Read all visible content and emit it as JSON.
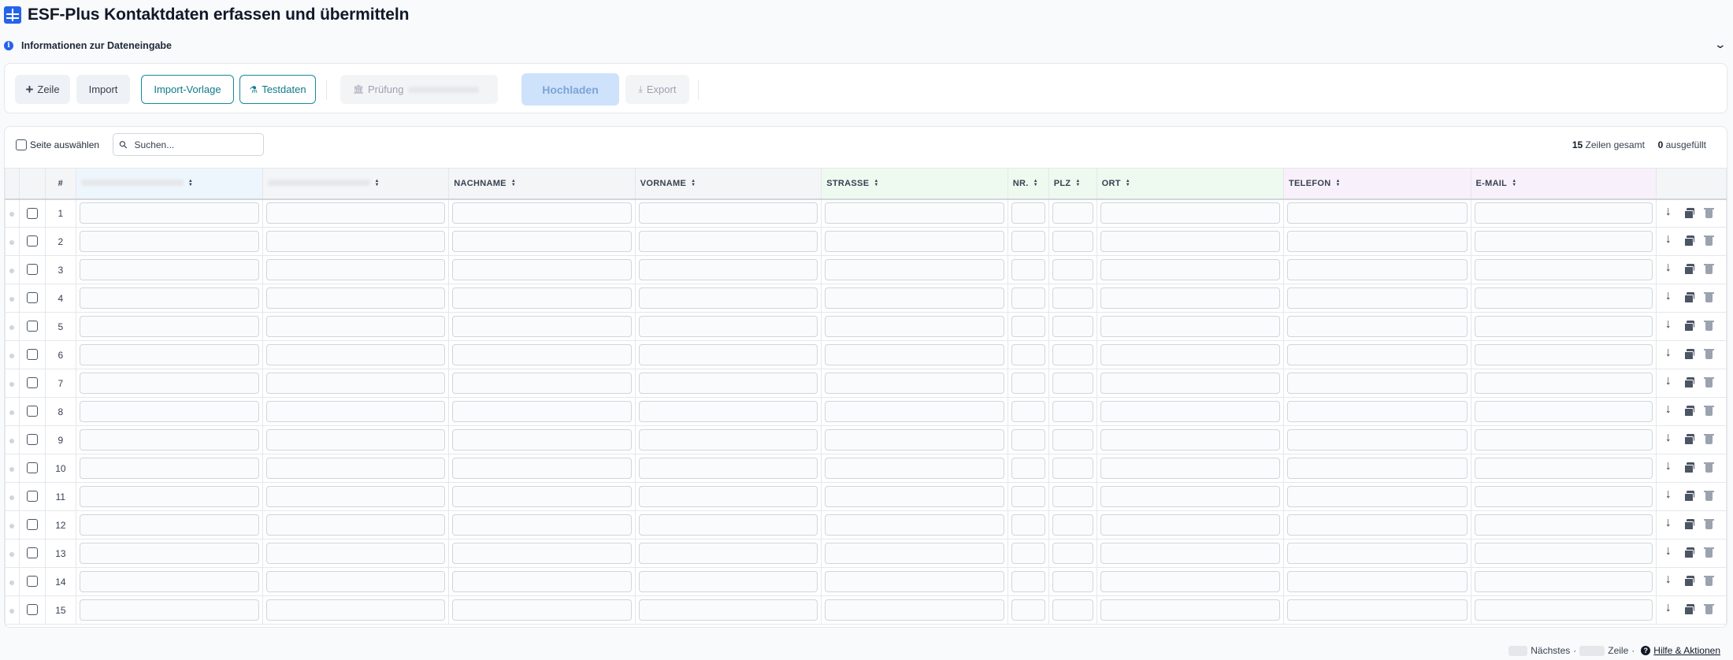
{
  "header": {
    "title": "ESF-Plus Kontaktdaten erfassen und übermitteln",
    "icon": "table-icon"
  },
  "info": {
    "label": "Informationen zur Dateneingabe"
  },
  "toolbar": {
    "add_row": "Zeile",
    "import": "Import",
    "import_template": "Import-Vorlage",
    "test_data": "Testdaten",
    "check": "Prüfung",
    "upload": "Hochladen",
    "export": "Export"
  },
  "table_controls": {
    "select_page": "Seite auswählen",
    "search_placeholder": "Suchen...",
    "rows_total": "15",
    "rows_total_label": "Zeilen gesamt",
    "filled": "0",
    "filled_label": "ausgefüllt"
  },
  "columns": [
    {
      "key": "c1",
      "label": "",
      "color": "#eef6fd"
    },
    {
      "key": "c2",
      "label": "",
      "color": "#f4f5f7"
    },
    {
      "key": "nachname",
      "label": "NACHNAME",
      "color": "#f4f5f7"
    },
    {
      "key": "vorname",
      "label": "VORNAME",
      "color": "#f4f5f7"
    },
    {
      "key": "strasse",
      "label": "STRASSE",
      "color": "#eefaf0"
    },
    {
      "key": "nr",
      "label": "NR.",
      "color": "#eefaf0"
    },
    {
      "key": "plz",
      "label": "PLZ",
      "color": "#eefaf0"
    },
    {
      "key": "ort",
      "label": "ORT",
      "color": "#eefaf0"
    },
    {
      "key": "telefon",
      "label": "TELEFON",
      "color": "#f8f1fb"
    },
    {
      "key": "email",
      "label": "E-MAIL",
      "color": "#f8f1fb"
    }
  ],
  "row_header": "#",
  "rows": [
    "1",
    "2",
    "3",
    "4",
    "5",
    "6",
    "7",
    "8",
    "9",
    "10",
    "11",
    "12",
    "13",
    "14",
    "15"
  ],
  "footer": {
    "next": "Nächstes",
    "row": "Zeile",
    "help": "Hilfe & Aktionen"
  }
}
